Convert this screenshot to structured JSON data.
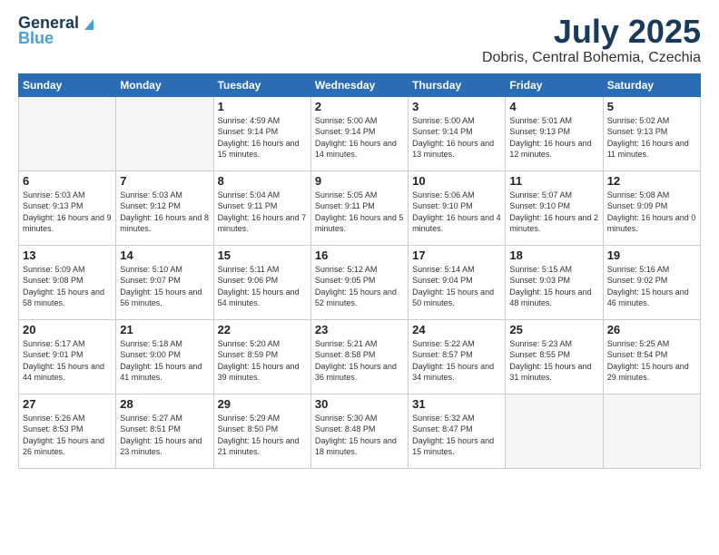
{
  "header": {
    "logo_line1": "General",
    "logo_line2": "Blue",
    "month": "July 2025",
    "location": "Dobris, Central Bohemia, Czechia"
  },
  "weekdays": [
    "Sunday",
    "Monday",
    "Tuesday",
    "Wednesday",
    "Thursday",
    "Friday",
    "Saturday"
  ],
  "weeks": [
    [
      {
        "day": "",
        "info": ""
      },
      {
        "day": "",
        "info": ""
      },
      {
        "day": "1",
        "info": "Sunrise: 4:59 AM\nSunset: 9:14 PM\nDaylight: 16 hours and 15 minutes."
      },
      {
        "day": "2",
        "info": "Sunrise: 5:00 AM\nSunset: 9:14 PM\nDaylight: 16 hours and 14 minutes."
      },
      {
        "day": "3",
        "info": "Sunrise: 5:00 AM\nSunset: 9:14 PM\nDaylight: 16 hours and 13 minutes."
      },
      {
        "day": "4",
        "info": "Sunrise: 5:01 AM\nSunset: 9:13 PM\nDaylight: 16 hours and 12 minutes."
      },
      {
        "day": "5",
        "info": "Sunrise: 5:02 AM\nSunset: 9:13 PM\nDaylight: 16 hours and 11 minutes."
      }
    ],
    [
      {
        "day": "6",
        "info": "Sunrise: 5:03 AM\nSunset: 9:13 PM\nDaylight: 16 hours and 9 minutes."
      },
      {
        "day": "7",
        "info": "Sunrise: 5:03 AM\nSunset: 9:12 PM\nDaylight: 16 hours and 8 minutes."
      },
      {
        "day": "8",
        "info": "Sunrise: 5:04 AM\nSunset: 9:11 PM\nDaylight: 16 hours and 7 minutes."
      },
      {
        "day": "9",
        "info": "Sunrise: 5:05 AM\nSunset: 9:11 PM\nDaylight: 16 hours and 5 minutes."
      },
      {
        "day": "10",
        "info": "Sunrise: 5:06 AM\nSunset: 9:10 PM\nDaylight: 16 hours and 4 minutes."
      },
      {
        "day": "11",
        "info": "Sunrise: 5:07 AM\nSunset: 9:10 PM\nDaylight: 16 hours and 2 minutes."
      },
      {
        "day": "12",
        "info": "Sunrise: 5:08 AM\nSunset: 9:09 PM\nDaylight: 16 hours and 0 minutes."
      }
    ],
    [
      {
        "day": "13",
        "info": "Sunrise: 5:09 AM\nSunset: 9:08 PM\nDaylight: 15 hours and 58 minutes."
      },
      {
        "day": "14",
        "info": "Sunrise: 5:10 AM\nSunset: 9:07 PM\nDaylight: 15 hours and 56 minutes."
      },
      {
        "day": "15",
        "info": "Sunrise: 5:11 AM\nSunset: 9:06 PM\nDaylight: 15 hours and 54 minutes."
      },
      {
        "day": "16",
        "info": "Sunrise: 5:12 AM\nSunset: 9:05 PM\nDaylight: 15 hours and 52 minutes."
      },
      {
        "day": "17",
        "info": "Sunrise: 5:14 AM\nSunset: 9:04 PM\nDaylight: 15 hours and 50 minutes."
      },
      {
        "day": "18",
        "info": "Sunrise: 5:15 AM\nSunset: 9:03 PM\nDaylight: 15 hours and 48 minutes."
      },
      {
        "day": "19",
        "info": "Sunrise: 5:16 AM\nSunset: 9:02 PM\nDaylight: 15 hours and 46 minutes."
      }
    ],
    [
      {
        "day": "20",
        "info": "Sunrise: 5:17 AM\nSunset: 9:01 PM\nDaylight: 15 hours and 44 minutes."
      },
      {
        "day": "21",
        "info": "Sunrise: 5:18 AM\nSunset: 9:00 PM\nDaylight: 15 hours and 41 minutes."
      },
      {
        "day": "22",
        "info": "Sunrise: 5:20 AM\nSunset: 8:59 PM\nDaylight: 15 hours and 39 minutes."
      },
      {
        "day": "23",
        "info": "Sunrise: 5:21 AM\nSunset: 8:58 PM\nDaylight: 15 hours and 36 minutes."
      },
      {
        "day": "24",
        "info": "Sunrise: 5:22 AM\nSunset: 8:57 PM\nDaylight: 15 hours and 34 minutes."
      },
      {
        "day": "25",
        "info": "Sunrise: 5:23 AM\nSunset: 8:55 PM\nDaylight: 15 hours and 31 minutes."
      },
      {
        "day": "26",
        "info": "Sunrise: 5:25 AM\nSunset: 8:54 PM\nDaylight: 15 hours and 29 minutes."
      }
    ],
    [
      {
        "day": "27",
        "info": "Sunrise: 5:26 AM\nSunset: 8:53 PM\nDaylight: 15 hours and 26 minutes."
      },
      {
        "day": "28",
        "info": "Sunrise: 5:27 AM\nSunset: 8:51 PM\nDaylight: 15 hours and 23 minutes."
      },
      {
        "day": "29",
        "info": "Sunrise: 5:29 AM\nSunset: 8:50 PM\nDaylight: 15 hours and 21 minutes."
      },
      {
        "day": "30",
        "info": "Sunrise: 5:30 AM\nSunset: 8:48 PM\nDaylight: 15 hours and 18 minutes."
      },
      {
        "day": "31",
        "info": "Sunrise: 5:32 AM\nSunset: 8:47 PM\nDaylight: 15 hours and 15 minutes."
      },
      {
        "day": "",
        "info": ""
      },
      {
        "day": "",
        "info": ""
      }
    ]
  ]
}
